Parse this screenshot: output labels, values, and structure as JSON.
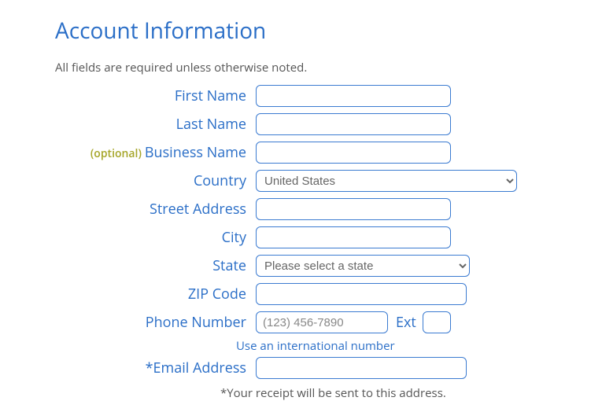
{
  "title": "Account Information",
  "subtitle": "All fields are required unless otherwise noted.",
  "optional_tag": "(optional)",
  "labels": {
    "first_name": "First Name",
    "last_name": "Last Name",
    "business_name": "Business Name",
    "country": "Country",
    "street": "Street Address",
    "city": "City",
    "state": "State",
    "zip": "ZIP Code",
    "phone": "Phone Number",
    "ext": "Ext",
    "email": "*Email Address"
  },
  "country_selected": "United States",
  "state_placeholder": "Please select a state",
  "phone_placeholder": "(123) 456-7890",
  "intl_link": "Use an international number",
  "email_note": "*Your receipt will be sent to this address."
}
